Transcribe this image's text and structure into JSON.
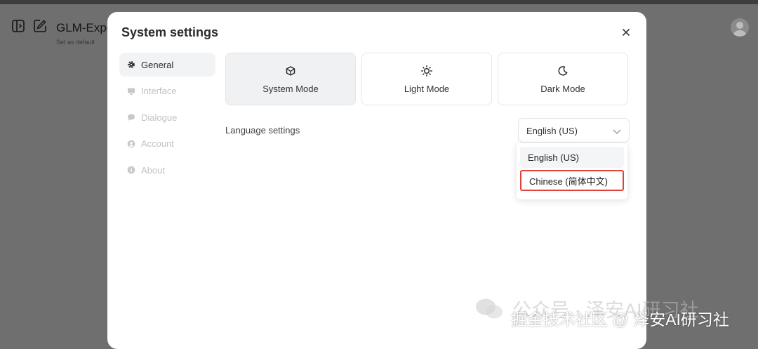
{
  "app": {
    "title": "GLM-Expe",
    "subtitle": "Set as default",
    "icons": [
      "sidebar-toggle-icon",
      "new-chat-icon",
      "avatar-icon"
    ]
  },
  "modal": {
    "title": "System settings",
    "close_icon": "close-icon",
    "nav": [
      {
        "label": "General",
        "icon": "gear-icon",
        "active": true
      },
      {
        "label": "Interface",
        "icon": "monitor-icon",
        "active": false
      },
      {
        "label": "Dialogue",
        "icon": "chat-bubble-icon",
        "active": false
      },
      {
        "label": "Account",
        "icon": "user-icon",
        "active": false
      },
      {
        "label": "About",
        "icon": "info-icon",
        "active": false
      }
    ],
    "modes": [
      {
        "label": "System Mode",
        "icon": "system-mode-icon",
        "active": true
      },
      {
        "label": "Light Mode",
        "icon": "sun-icon",
        "active": false
      },
      {
        "label": "Dark Mode",
        "icon": "moon-icon",
        "active": false
      }
    ],
    "language": {
      "label": "Language settings",
      "selected": "English (US)",
      "options": [
        "English (US)",
        "Chinese (简体中文)"
      ],
      "highlighted_option": "Chinese (简体中文)",
      "highlight_color": "#e0433a"
    }
  },
  "watermark": {
    "faint": "公众号 · 泽安AI研习社",
    "strong": "掘金技术社区 @ 泽安AI研习社"
  }
}
